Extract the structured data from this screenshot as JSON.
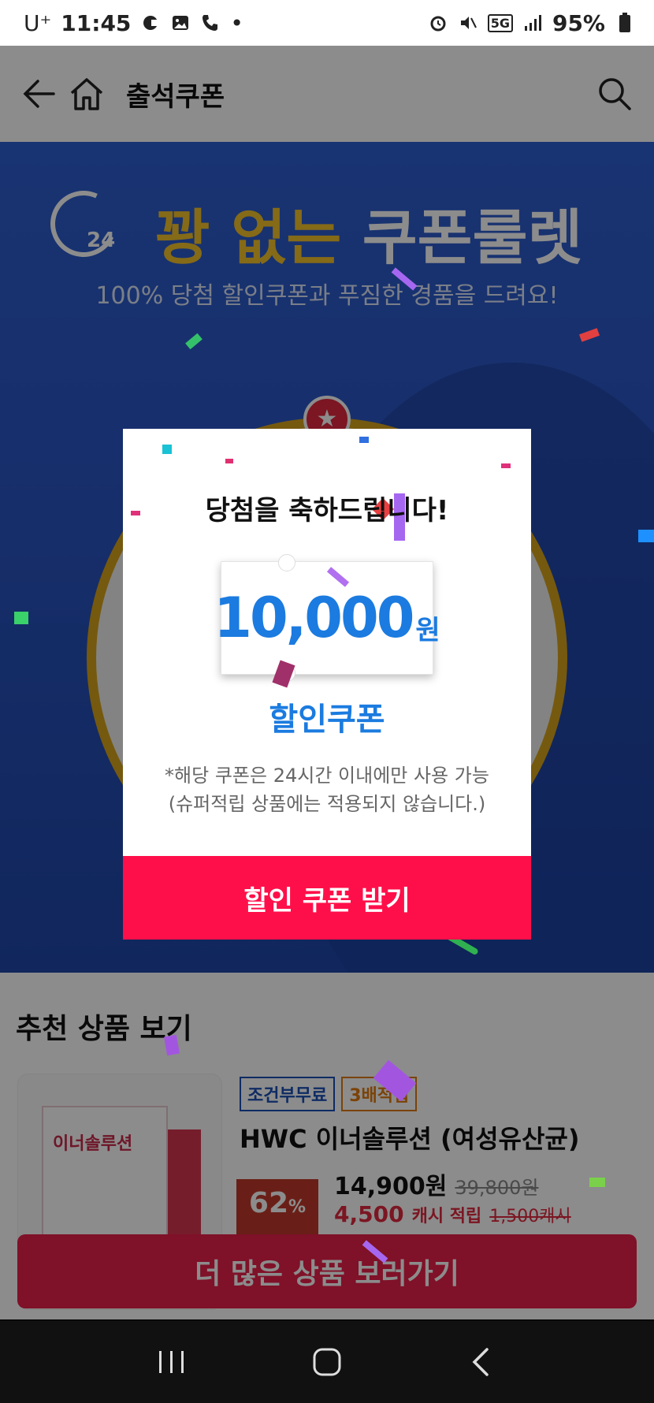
{
  "status_bar": {
    "carrier": "U⁺",
    "time": "11:45",
    "network": "5G",
    "battery": "95%"
  },
  "header": {
    "title": "출석쿠폰",
    "icons": [
      "back-arrow-icon",
      "home-icon",
      "search-icon"
    ]
  },
  "banner": {
    "title_part1": "꽝 없는",
    "title_part2": "쿠폰룰렛",
    "clock_label": "24",
    "subtitle": "100% 당첨 할인쿠폰과 푸짐한 경품을 드려요!"
  },
  "modal": {
    "title": "당첨을 축하드립니다!",
    "amount": "10,000",
    "unit": "원",
    "coupon_type": "할인쿠폰",
    "note_line1": "*해당 쿠폰은 24시간 이내에만 사용 가능",
    "note_line2": "(슈퍼적립 상품에는 적용되지 않습니다.)",
    "button_label": "할인 쿠폰 받기"
  },
  "recommended": {
    "section_title": "추천 상품 보기",
    "product": {
      "tags": [
        "조건부무료",
        "3배적립"
      ],
      "name": "HWC 이너솔루션 (여성유산균)",
      "price": "14,900원",
      "original_price": "39,800원",
      "cash": "4,500",
      "cash_label": "캐시 적립",
      "cash_original": "1,500캐시",
      "discount": "62",
      "image_text": "이너솔루션"
    },
    "more_button": "더 많은 상품 보러가기"
  },
  "colors": {
    "accent_red": "#ff0f4a",
    "accent_blue": "#1b7be0",
    "banner_blue": "#2a56c4",
    "gold": "#f3c22b"
  }
}
